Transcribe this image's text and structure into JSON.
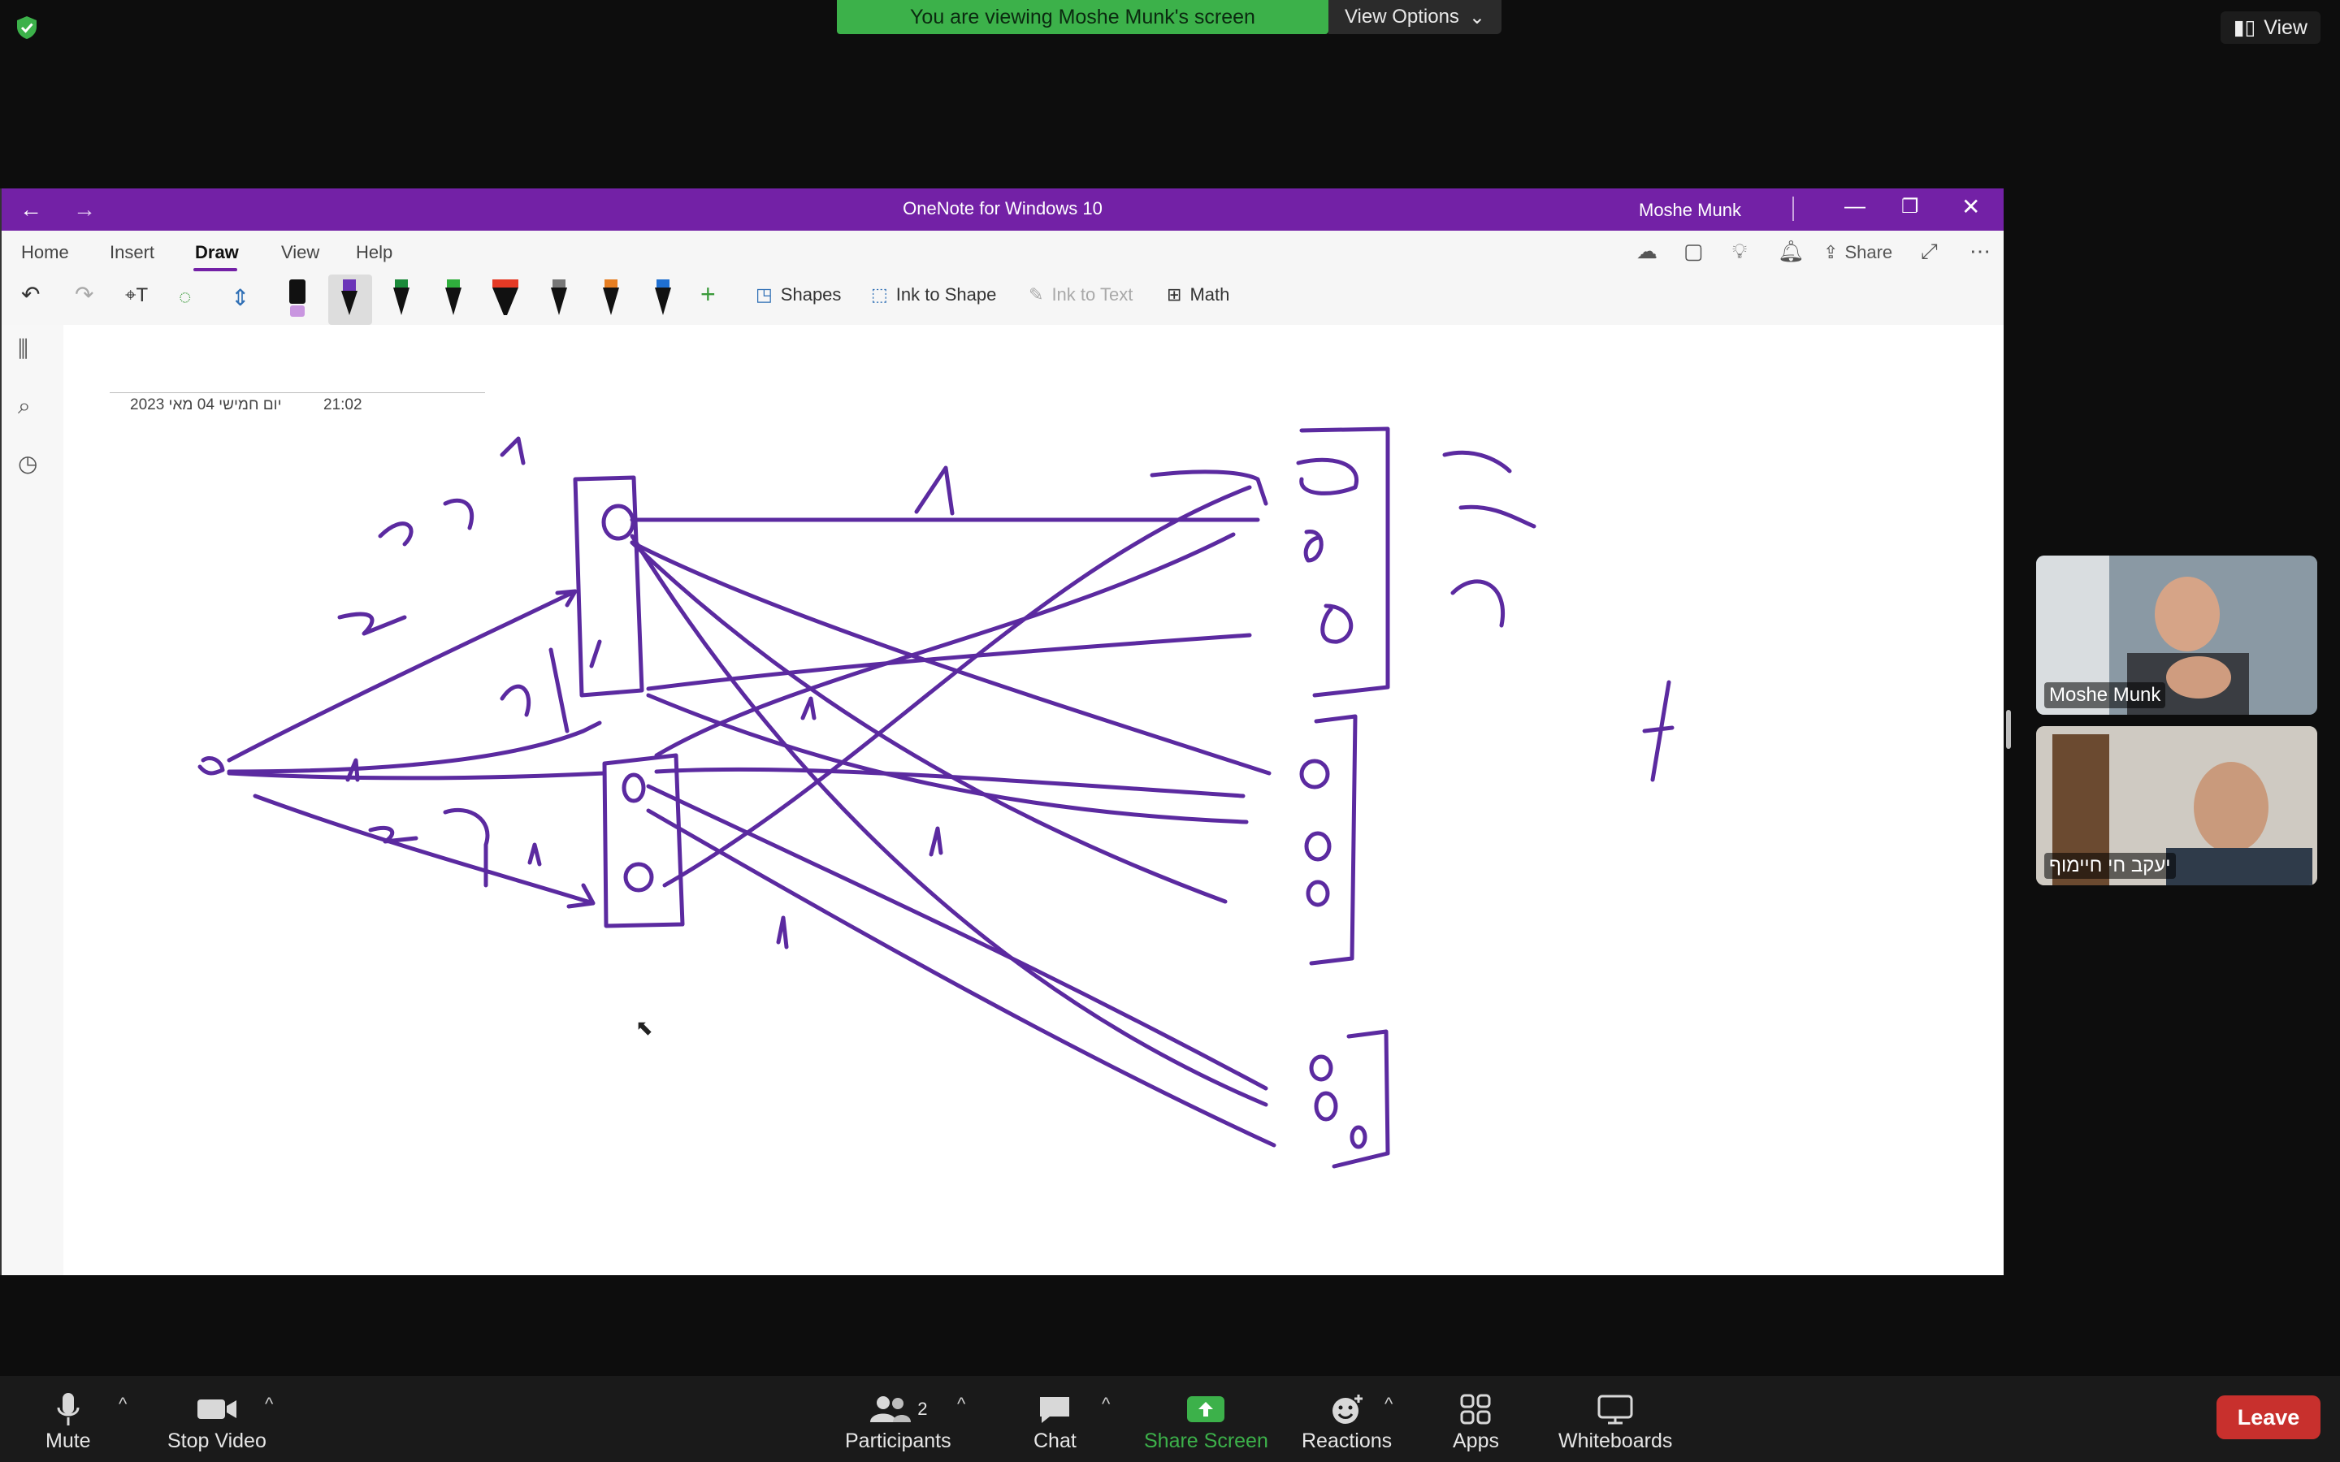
{
  "zoom": {
    "banner": "You are viewing Moshe Munk's screen",
    "view_options": "View Options",
    "view_button": "View",
    "participants": [
      {
        "name": "Moshe Munk"
      },
      {
        "name": "יעקב חי חיימוף"
      }
    ],
    "toolbar": {
      "mute": "Mute",
      "stop_video": "Stop Video",
      "participants": "Participants",
      "participants_count": "2",
      "chat": "Chat",
      "share_screen": "Share Screen",
      "reactions": "Reactions",
      "apps": "Apps",
      "whiteboards": "Whiteboards",
      "leave": "Leave"
    },
    "colors": {
      "banner": "#3cb14a",
      "leave": "#c8302d",
      "share": "#3cb14a"
    }
  },
  "onenote": {
    "title": "OneNote for Windows 10",
    "user": "Moshe Munk",
    "tabs": [
      "Home",
      "Insert",
      "Draw",
      "View",
      "Help"
    ],
    "active_tab": "Draw",
    "ribbon": {
      "shapes": "Shapes",
      "ink_to_shape": "Ink to Shape",
      "ink_to_text": "Ink to Text",
      "math": "Math"
    },
    "share": "Share",
    "page": {
      "date": "יום חמישי 04 מאי 2023",
      "time": "21:02"
    },
    "colors": {
      "title_bar": "#7321a6",
      "ink": "#5b2aa0"
    }
  }
}
